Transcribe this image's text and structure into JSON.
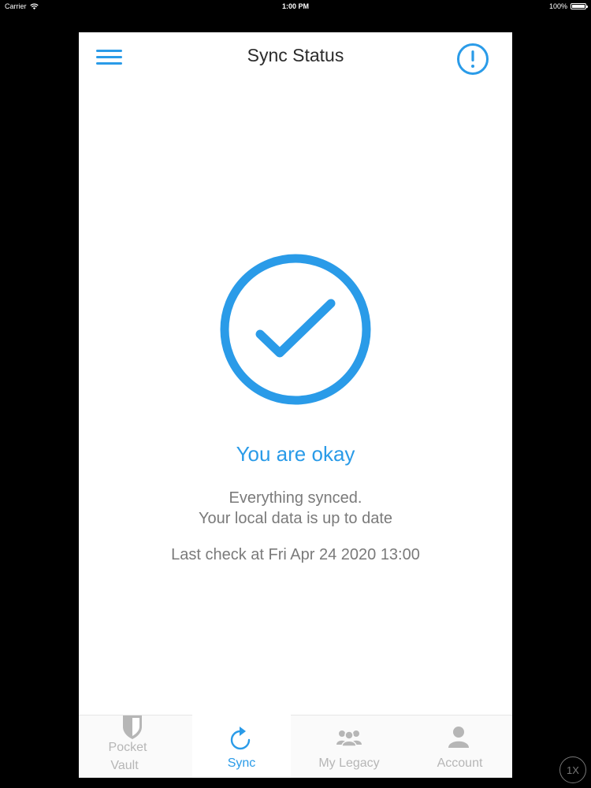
{
  "status_bar": {
    "carrier": "Carrier",
    "time": "1:00 PM",
    "battery": "100%"
  },
  "header": {
    "title": "Sync Status",
    "menu_icon": "hamburger-menu-icon",
    "alert_icon": "exclamation-circle-icon"
  },
  "sync": {
    "icon": "checkmark-circle-icon",
    "headline": "You are okay",
    "detail_line1": "Everything synced.",
    "detail_line2": "Your local data is up to date",
    "last_check": "Last check at Fri Apr 24 2020 13:00"
  },
  "tabs": [
    {
      "label_line1": "Pocket",
      "label_line2": "Vault",
      "icon": "shield-icon",
      "active": false
    },
    {
      "label": "Sync",
      "icon": "refresh-icon",
      "active": true
    },
    {
      "label": "My Legacy",
      "icon": "people-group-icon",
      "active": false
    },
    {
      "label": "Account",
      "icon": "person-icon",
      "active": false
    }
  ],
  "zoom_badge": "1X",
  "colors": {
    "accent": "#2a9be8",
    "muted_text": "#7a7a7a",
    "inactive_tab": "#b6b6b6"
  }
}
